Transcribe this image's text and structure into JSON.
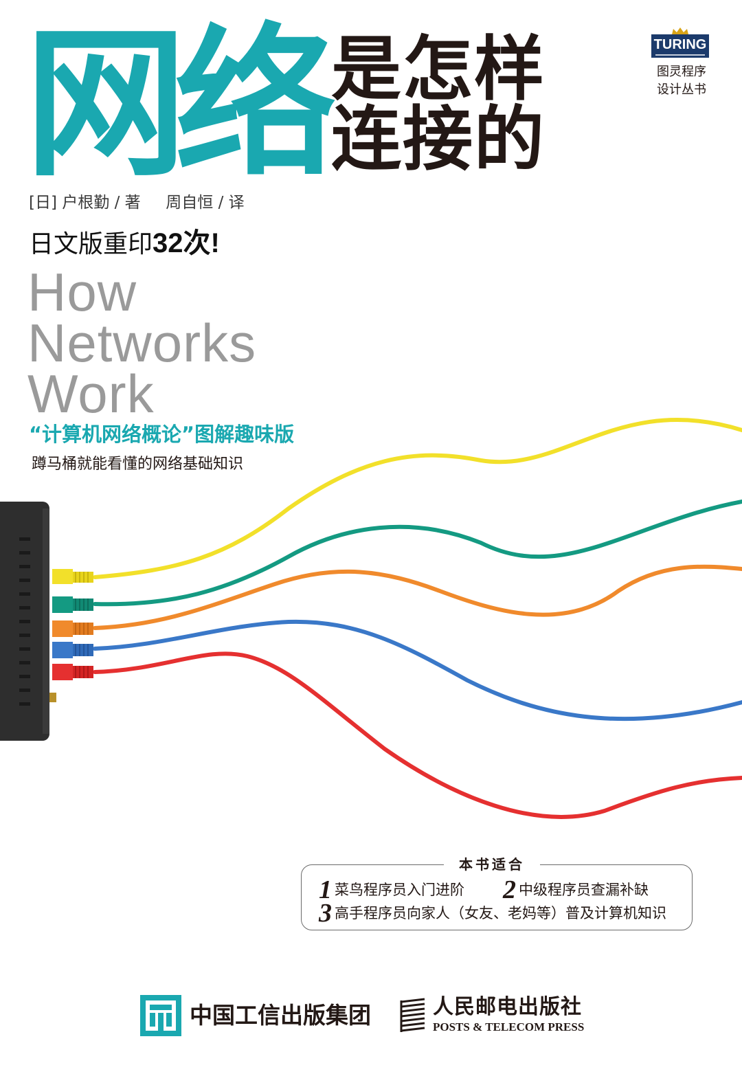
{
  "cover": {
    "title_big": "网络",
    "title_line1": "是怎样",
    "title_line2": "连接的",
    "series_logo": "TURING",
    "series_line1": "图灵程序",
    "series_line2": "设计丛书",
    "author_country": "[日]",
    "author_name": "户根勤",
    "author_role": "/ 著",
    "translator_name": "周自恒",
    "translator_role": "/ 译",
    "reprint_prefix": "日文版重印",
    "reprint_count": "32次!",
    "english_title_line1": "How",
    "english_title_line2": "Networks",
    "english_title_line3": "Work",
    "subtitle_highlight": "“计算机网络概论”图解趣味版",
    "subtitle_tagline": "蹲马桶就能看懂的网络基础知识",
    "audience": {
      "heading": "本书适合",
      "items": [
        {
          "num": "1",
          "text": "菜鸟程序员入门进阶"
        },
        {
          "num": "2",
          "text": "中级程序员查漏补缺"
        },
        {
          "num": "3",
          "text": "高手程序员向家人（女友、老妈等）普及计算机知识"
        }
      ]
    },
    "publisher1_name": "中国工信出版集团",
    "publisher2_name_cn": "人民邮电出版社",
    "publisher2_name_en": "POSTS & TELECOM PRESS"
  },
  "colors": {
    "accent_teal": "#1aa8b0",
    "cable_yellow": "#f2e02a",
    "cable_green": "#149a82",
    "cable_orange": "#f08a2c",
    "cable_blue": "#3a78c8",
    "cable_red": "#e53030",
    "router_body": "#2e2e2e",
    "turing_blue": "#1b3a6b"
  }
}
